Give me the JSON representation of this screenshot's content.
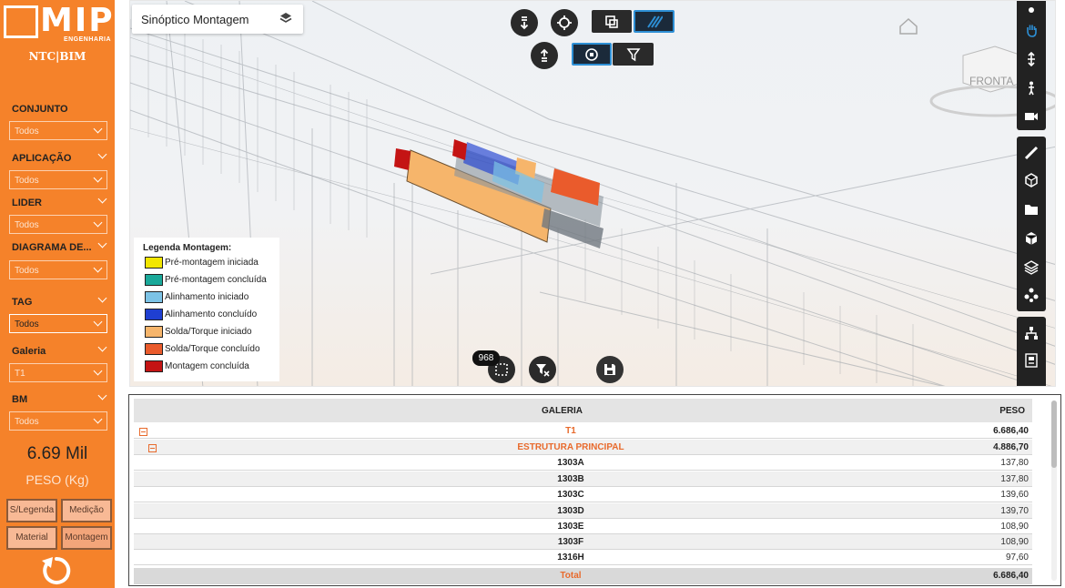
{
  "brand": {
    "logo": "MIP",
    "subtitle": "ENGENHARIA",
    "tagline": "NTC|BIM"
  },
  "filters": [
    {
      "label": "CONJUNTO",
      "value": "Todos"
    },
    {
      "label": "APLICAÇÃO",
      "value": "Todos"
    },
    {
      "label": "LIDER",
      "value": "Todos"
    },
    {
      "label": "DIAGRAMA DE...",
      "value": "Todos"
    },
    {
      "label": "TAG",
      "value": "Todos"
    },
    {
      "label": "Galeria",
      "value": "T1"
    },
    {
      "label": "BM",
      "value": "Todos"
    }
  ],
  "kpi": {
    "value": "6.69 Mil",
    "label": "PESO (Kg)"
  },
  "mode_buttons": [
    "S/Legenda",
    "Medição",
    "Material",
    "Montagem"
  ],
  "viewer": {
    "title": "Sinóptico Montagem",
    "selection_count": "968",
    "viewcube_label": "FRONTA"
  },
  "legend": {
    "title": "Legenda Montagem:",
    "items": [
      {
        "label": "Pré-montagem iniciada",
        "color": "#f2e600"
      },
      {
        "label": "Pré-montagem concluída",
        "color": "#1aa99a"
      },
      {
        "label": "Alinhamento iniciado",
        "color": "#7cc3e6"
      },
      {
        "label": "Alinhamento concluído",
        "color": "#1f3fd1"
      },
      {
        "label": "Solda/Torque iniciado",
        "color": "#f6b56b"
      },
      {
        "label": "Solda/Torque concluído",
        "color": "#ea5b2c"
      },
      {
        "label": "Montagem concluída",
        "color": "#c41414"
      }
    ]
  },
  "table": {
    "headers": {
      "galeria": "GALERIA",
      "peso": "PESO"
    },
    "group": {
      "name": "T1",
      "peso": "6.686,40"
    },
    "subgroup": {
      "name": "ESTRUTURA PRINCIPAL",
      "peso": "4.886,70"
    },
    "rows": [
      {
        "name": "1303A",
        "peso": "137,80"
      },
      {
        "name": "1303B",
        "peso": "137,80"
      },
      {
        "name": "1303C",
        "peso": "139,60"
      },
      {
        "name": "1303D",
        "peso": "139,70"
      },
      {
        "name": "1303E",
        "peso": "108,90"
      },
      {
        "name": "1303F",
        "peso": "108,90"
      },
      {
        "name": "1316H",
        "peso": "97,60"
      }
    ],
    "total": {
      "label": "Total",
      "peso": "6.686,40"
    }
  },
  "colors": {
    "sidebar": "#f5822a",
    "accent": "#e86a2c",
    "toolbar": "#222222",
    "active_blue": "#2d8fd5"
  }
}
